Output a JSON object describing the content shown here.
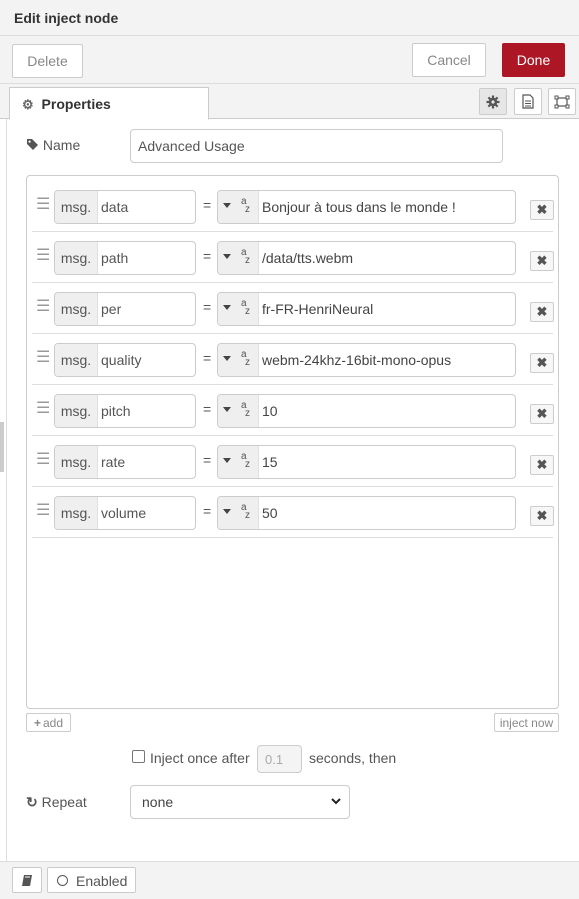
{
  "header": {
    "title": "Edit inject node"
  },
  "toolbar": {
    "delete_label": "Delete",
    "cancel_label": "Cancel",
    "done_label": "Done",
    "done_color": "#ad1625"
  },
  "tabs": {
    "properties_label": "Properties",
    "icons": [
      "gear-icon",
      "description-icon",
      "appearance-icon"
    ]
  },
  "form": {
    "name_label": "Name",
    "name_value": "Advanced Usage",
    "props": [
      {
        "prefix": "msg.",
        "name": "data",
        "type": "string",
        "value": "Bonjour à tous dans le monde !"
      },
      {
        "prefix": "msg.",
        "name": "path",
        "type": "string",
        "value": "/data/tts.webm"
      },
      {
        "prefix": "msg.",
        "name": "per",
        "type": "string",
        "value": "fr-FR-HenriNeural"
      },
      {
        "prefix": "msg.",
        "name": "quality",
        "type": "string",
        "value": "webm-24khz-16bit-mono-opus"
      },
      {
        "prefix": "msg.",
        "name": "pitch",
        "type": "string",
        "value": "10"
      },
      {
        "prefix": "msg.",
        "name": "rate",
        "type": "string",
        "value": "15"
      },
      {
        "prefix": "msg.",
        "name": "volume",
        "type": "string",
        "value": "50"
      }
    ],
    "equals": "=",
    "type_a": "a",
    "type_z": "z",
    "add_label": "add",
    "inject_now_label": "inject now",
    "inject_once_label": "Inject once after",
    "inject_once_checked": false,
    "delay_placeholder": "0.1",
    "seconds_label": "seconds, then",
    "repeat_label": "Repeat",
    "repeat_value": "none"
  },
  "footer": {
    "enabled_label": "Enabled"
  }
}
